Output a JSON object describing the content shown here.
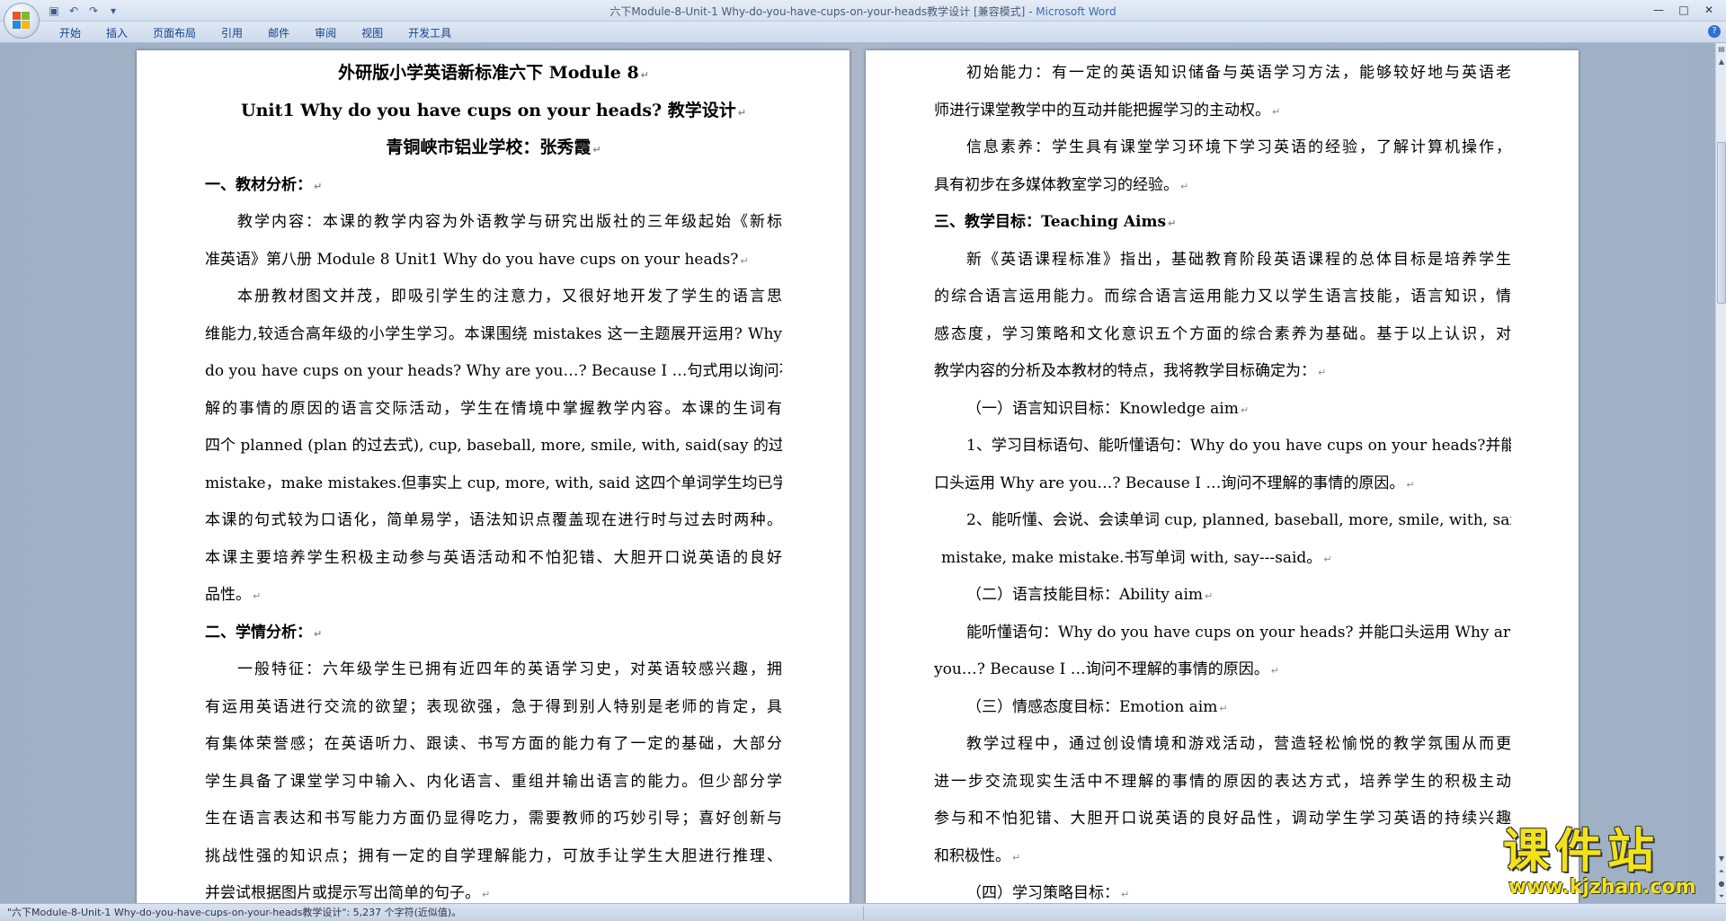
{
  "window": {
    "title": "六下Module-8-Unit-1 Why-do-you-have-cups-on-your-heads教学设计 [兼容模式] - ",
    "app_name": "Microsoft Word",
    "controls": [
      "—",
      "□",
      "✕"
    ]
  },
  "quick_access": [
    "save",
    "undo",
    "redo",
    "customize"
  ],
  "ribbon": {
    "tabs": [
      "开始",
      "插入",
      "页面布局",
      "引用",
      "邮件",
      "审阅",
      "视图",
      "开发工具"
    ]
  },
  "left_page": {
    "title1": "外研版小学英语新标准六下 Module 8",
    "title2": "Unit1 Why do you have cups on your heads?  教学设计",
    "title3": "青铜峡市铝业学校：张秀霞",
    "sec1": "一、教材分析：",
    "p1_l1": "教学内容：本课的教学内容为外语教学与研究出版社的三年级起始《新标",
    "p1_l2": "准英语》第八册 Module 8 Unit1 Why do you have cups on your heads?",
    "p2_l1": "本册教材图文并茂，即吸引学生的注意力，又很好地开发了学生的语言思",
    "p2_l2": "维能力,较适合高年级的小学生学习。本课围绕 mistakes 这一主题展开运用? Why",
    "p2_l3": "do you have cups on your heads? Why are you…? Because I …句式用以询问不理",
    "p2_l4": "解的事情的原因的语言交际活动，学生在情境中掌握教学内容。本课的生词有",
    "p2_l5": "四个 planned (plan 的过去式), cup, baseball, more, smile, with, said(say 的过去式),",
    "p2_l6": "mistake，make mistakes.但事实上 cup, more, with, said 这四个单词学生均已学过。",
    "p2_l7": "本课的句式较为口语化，简单易学，语法知识点覆盖现在进行时与过去时两种。",
    "p2_l8": "本课主要培养学生积极主动参与英语活动和不怕犯错、大胆开口说英语的良好",
    "p2_l9": "品性。",
    "sec2": "二、学情分析：",
    "p3_l1": "一般特征：六年级学生已拥有近四年的英语学习史，对英语较感兴趣，拥",
    "p3_l2": "有运用英语进行交流的欲望；表现欲强，急于得到别人特别是老师的肯定，具",
    "p3_l3": "有集体荣誉感；在英语听力、跟读、书写方面的能力有了一定的基础，大部分",
    "p3_l4": "学生具备了课堂学习中输入、内化语言、重组并输出语言的能力。但少部分学",
    "p3_l5": "生在语言表达和书写能力方面仍显得吃力，需要教师的巧妙引导；喜好创新与",
    "p3_l6": "挑战性强的知识点；拥有一定的自学理解能力，可放手让学生大胆进行推理、",
    "p3_l7": "并尝试根据图片或提示写出简单的句子。"
  },
  "right_page": {
    "r1": "初始能力：有一定的英语知识储备与英语学习方法，能够较好地与英语老",
    "r2": "师进行课堂教学中的互动并能把握学习的主动权。",
    "r3": "信息素养：学生具有课堂学习环境下学习英语的经验，了解计算机操作，",
    "r4": "具有初步在多媒体教室学习的经验。",
    "r5": "三、教学目标：Teaching Aims",
    "r6": "新《英语课程标准》指出，基础教育阶段英语课程的总体目标是培养学生",
    "r7": "的综合语言运用能力。而综合语言运用能力又以学生语言技能，语言知识，情",
    "r8": "感态度，学习策略和文化意识五个方面的综合素养为基础。基于以上认识，对",
    "r9": "教学内容的分析及本教材的特点，我将教学目标确定为：",
    "r10": "（一）语言知识目标：Knowledge aim",
    "r11": "1、学习目标语句、能听懂语句：Why do you have cups on your heads?并能",
    "r12": "口头运用  Why are you…? Because I …询问不理解的事情的原因。",
    "r13": "2、能听懂、会说、会读单词 cup, planned, baseball, more, smile, with, said,",
    "r14": "mistake, make mistake.书写单词 with, say---said。",
    "r15": "（二）语言技能目标：Ability aim",
    "r16": "能听懂语句：Why do you have cups on your heads?  并能口头运用  Why are",
    "r17": "you…? Because I …询问不理解的事情的原因。",
    "r18": "（三）情感态度目标：Emotion aim",
    "r19": "教学过程中，通过创设情境和游戏活动，营造轻松愉悦的教学氛围从而更",
    "r20": "进一步交流现实生活中不理解的事情的原因的表达方式，培养学生的积极主动",
    "r21": "参与和不怕犯错、大胆开口说英语的良好品性，调动学生学习英语的持续兴趣",
    "r22": "和积极性。",
    "r23": "（四）学习策略目标："
  },
  "paragraph_mark": "↵",
  "statusbar": {
    "text": "\"六下Module-8-Unit-1 Why-do-you-have-cups-on-your-heads教学设计\": 5,237 个字符(近似值)。"
  },
  "watermark": {
    "cn": "课件站",
    "url": "www.kjzhan.com"
  }
}
